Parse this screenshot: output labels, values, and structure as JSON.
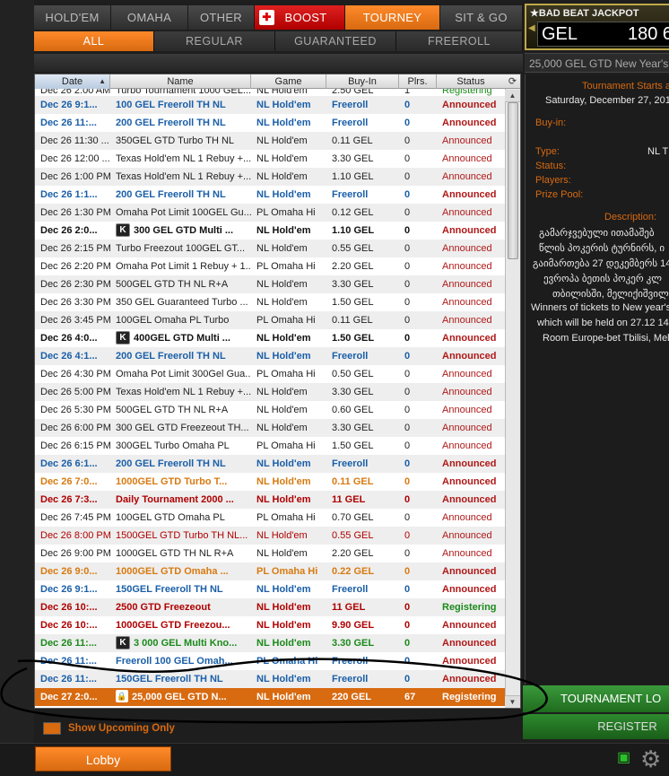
{
  "top_tabs": [
    "HOLD'EM",
    "OMAHA",
    "OTHER",
    "BOOST",
    "TOURNEY",
    "SIT & GO"
  ],
  "sub_tabs": [
    "ALL",
    "REGULAR",
    "GUARANTEED",
    "FREEROLL"
  ],
  "table": {
    "headers": [
      "Date",
      "Name",
      "Game",
      "Buy-In",
      "Plrs.",
      "Status"
    ],
    "rows": [
      {
        "date": "Dec 26 2:00 AM",
        "name": "Turbo Tournament 1000 GEL...",
        "game": "NL Hold'em",
        "buyin": "2.50 GEL",
        "plrs": "1",
        "status": "Registering"
      },
      {
        "date": "Dec 26 9:1...",
        "name": "100 GEL Freeroll TH NL",
        "game": "NL Hold'em",
        "buyin": "Freeroll",
        "plrs": "0",
        "status": "Announced"
      },
      {
        "date": "Dec 26 11:...",
        "name": "200 GEL Freeroll TH NL",
        "game": "NL Hold'em",
        "buyin": "Freeroll",
        "plrs": "0",
        "status": "Announced"
      },
      {
        "date": "Dec 26 11:30 ...",
        "name": "350GEL GTD Turbo TH NL",
        "game": "NL Hold'em",
        "buyin": "0.11 GEL",
        "plrs": "0",
        "status": "Announced"
      },
      {
        "date": "Dec 26 12:00 ...",
        "name": "Texas Hold'em NL 1 Rebuy +...",
        "game": "NL Hold'em",
        "buyin": "3.30 GEL",
        "plrs": "0",
        "status": "Announced"
      },
      {
        "date": "Dec 26 1:00 PM",
        "name": "Texas Hold'em NL 1 Rebuy +...",
        "game": "NL Hold'em",
        "buyin": "1.10 GEL",
        "plrs": "0",
        "status": "Announced"
      },
      {
        "date": "Dec 26 1:1...",
        "name": "200 GEL Freeroll TH NL",
        "game": "NL Hold'em",
        "buyin": "Freeroll",
        "plrs": "0",
        "status": "Announced"
      },
      {
        "date": "Dec 26 1:30 PM",
        "name": "Omaha Pot Limit 100GEL Gu...",
        "game": "PL Omaha Hi",
        "buyin": "0.12 GEL",
        "plrs": "0",
        "status": "Announced"
      },
      {
        "date": "Dec 26 2:0...",
        "name": "300 GEL GTD Multi ...",
        "game": "NL Hold'em",
        "buyin": "1.10 GEL",
        "plrs": "0",
        "status": "Announced"
      },
      {
        "date": "Dec 26 2:15 PM",
        "name": "Turbo Freezout 100GEL GT...",
        "game": "NL Hold'em",
        "buyin": "0.55 GEL",
        "plrs": "0",
        "status": "Announced"
      },
      {
        "date": "Dec 26 2:20 PM",
        "name": "Omaha Pot Limit 1 Rebuy + 1...",
        "game": "PL Omaha Hi",
        "buyin": "2.20 GEL",
        "plrs": "0",
        "status": "Announced"
      },
      {
        "date": "Dec 26 2:30 PM",
        "name": "500GEL GTD TH NL R+A",
        "game": "NL Hold'em",
        "buyin": "3.30 GEL",
        "plrs": "0",
        "status": "Announced"
      },
      {
        "date": "Dec 26 3:30 PM",
        "name": "350 GEL Guaranteed Turbo ...",
        "game": "NL Hold'em",
        "buyin": "1.50 GEL",
        "plrs": "0",
        "status": "Announced"
      },
      {
        "date": "Dec 26 3:45 PM",
        "name": "100GEL Omaha PL Turbo",
        "game": "PL Omaha Hi",
        "buyin": "0.11 GEL",
        "plrs": "0",
        "status": "Announced"
      },
      {
        "date": "Dec 26 4:0...",
        "name": "400GEL GTD Multi ...",
        "game": "NL Hold'em",
        "buyin": "1.50 GEL",
        "plrs": "0",
        "status": "Announced"
      },
      {
        "date": "Dec 26 4:1...",
        "name": "200 GEL Freeroll TH NL",
        "game": "NL Hold'em",
        "buyin": "Freeroll",
        "plrs": "0",
        "status": "Announced"
      },
      {
        "date": "Dec 26 4:30 PM",
        "name": "Omaha Pot Limit 300Gel Gua...",
        "game": "PL Omaha Hi",
        "buyin": "0.50 GEL",
        "plrs": "0",
        "status": "Announced"
      },
      {
        "date": "Dec 26 5:00 PM",
        "name": "Texas Hold'em NL 1 Rebuy +...",
        "game": "NL Hold'em",
        "buyin": "3.30 GEL",
        "plrs": "0",
        "status": "Announced"
      },
      {
        "date": "Dec 26 5:30 PM",
        "name": "500GEL GTD TH NL R+A",
        "game": "NL Hold'em",
        "buyin": "0.60 GEL",
        "plrs": "0",
        "status": "Announced"
      },
      {
        "date": "Dec 26 6:00 PM",
        "name": "300 GEL GTD Freezeout TH...",
        "game": "NL Hold'em",
        "buyin": "3.30 GEL",
        "plrs": "0",
        "status": "Announced"
      },
      {
        "date": "Dec 26 6:15 PM",
        "name": "300GEL Turbo Omaha PL",
        "game": "PL Omaha Hi",
        "buyin": "1.50 GEL",
        "plrs": "0",
        "status": "Announced"
      },
      {
        "date": "Dec 26 6:1...",
        "name": "200 GEL Freeroll TH NL",
        "game": "NL Hold'em",
        "buyin": "Freeroll",
        "plrs": "0",
        "status": "Announced"
      },
      {
        "date": "Dec 26 7:0...",
        "name": "1000GEL GTD Turbo T...",
        "game": "NL Hold'em",
        "buyin": "0.11 GEL",
        "plrs": "0",
        "status": "Announced"
      },
      {
        "date": "Dec 26 7:3...",
        "name": "Daily Tournament 2000 ...",
        "game": "NL Hold'em",
        "buyin": "11 GEL",
        "plrs": "0",
        "status": "Announced"
      },
      {
        "date": "Dec 26 7:45 PM",
        "name": "100GEL GTD Omaha PL",
        "game": "PL Omaha Hi",
        "buyin": "0.70 GEL",
        "plrs": "0",
        "status": "Announced"
      },
      {
        "date": "Dec 26 8:00 PM",
        "name": "1500GEL GTD Turbo TH NL...",
        "game": "NL Hold'em",
        "buyin": "0.55 GEL",
        "plrs": "0",
        "status": "Announced"
      },
      {
        "date": "Dec 26 9:00 PM",
        "name": "1000GEL GTD TH NL R+A",
        "game": "NL Hold'em",
        "buyin": "2.20 GEL",
        "plrs": "0",
        "status": "Announced"
      },
      {
        "date": "Dec 26 9:0...",
        "name": "1000GEL GTD Omaha ...",
        "game": "PL Omaha Hi",
        "buyin": "0.22 GEL",
        "plrs": "0",
        "status": "Announced"
      },
      {
        "date": "Dec 26 9:1...",
        "name": "150GEL Freeroll TH NL",
        "game": "NL Hold'em",
        "buyin": "Freeroll",
        "plrs": "0",
        "status": "Announced"
      },
      {
        "date": "Dec 26 10:...",
        "name": "2500 GTD  Freezeout",
        "game": "NL Hold'em",
        "buyin": "11 GEL",
        "plrs": "0",
        "status": "Registering"
      },
      {
        "date": "Dec 26 10:...",
        "name": "1000GEL GTD Freezou...",
        "game": "NL Hold'em",
        "buyin": "9.90 GEL",
        "plrs": "0",
        "status": "Announced"
      },
      {
        "date": "Dec 26 11:...",
        "name": "3 000 GEL Multi Kno...",
        "game": "NL Hold'em",
        "buyin": "3.30 GEL",
        "plrs": "0",
        "status": "Announced"
      },
      {
        "date": "Dec 26 11:...",
        "name": "Freeroll 100 GEL Omah...",
        "game": "PL Omaha Hi",
        "buyin": "Freeroll",
        "plrs": "0",
        "status": "Announced"
      },
      {
        "date": "Dec 26 11:...",
        "name": "150GEL Freeroll TH NL",
        "game": "NL Hold'em",
        "buyin": "Freeroll",
        "plrs": "0",
        "status": "Announced"
      },
      {
        "date": "Dec 27 2:0...",
        "name": "25,000 GEL GTD N...",
        "game": "NL Hold'em",
        "buyin": "220 GEL",
        "plrs": "67",
        "status": "Registering"
      }
    ]
  },
  "show_upcoming_label": "Show Upcoming Only",
  "lobby_label": "Lobby",
  "jackpot": {
    "title": "BAD BEAT JACKPOT",
    "currency": "GEL",
    "value": "180 6"
  },
  "right_panel": {
    "tourney_name": "25,000 GEL GTD New Year's",
    "starts_label": "Tournament Starts a",
    "starts_date": "Saturday, December 27, 201",
    "buyin_label": "Buy-in:",
    "type_label": "Type:",
    "type_value": "NL T",
    "status_label": "Status:",
    "players_label": "Players:",
    "prize_label": "Prize Pool:",
    "desc_label": "Description:",
    "desc_lines": [
      "გამარჯვებული ითამაშებ",
      "წლის პოკერის ტურნირს, ი",
      "გაიმართება 27 დეკემბერს 14",
      "ევროპა ბეთის პოკერ კლ",
      "თბილისში, მელიქიშვილ",
      "Winners of tickets to New year's",
      "which will be held on 27.12 14:",
      "Room Europe-bet Tbilisi, Meli"
    ],
    "tourney_lobby_label": "TOURNAMENT LO",
    "register_label": "REGISTER"
  },
  "colors": {
    "accent": "#d86a10",
    "freeroll_blue": "#1a5fa8",
    "guaranteed_orange": "#d87a10",
    "special_red": "#b00000",
    "multi_green": "#1a8a1a",
    "announced_red": "#b01818",
    "registering_green": "#1a8a1a"
  }
}
